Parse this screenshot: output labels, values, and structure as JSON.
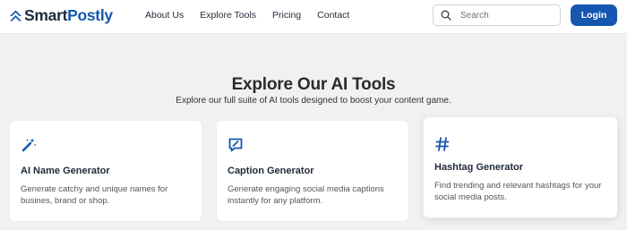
{
  "header": {
    "logo_text_dark": "Smart",
    "logo_text_brand": "Postly",
    "nav": [
      "About Us",
      "Explore Tools",
      "Pricing",
      "Contact"
    ],
    "search_placeholder": "Search",
    "login_label": "Login"
  },
  "hero": {
    "title": "Explore Our AI Tools",
    "subtitle": "Explore our full suite of AI tools designed to boost your content game."
  },
  "tools": [
    {
      "icon": "magic-wand-icon",
      "title": "AI Name Generator",
      "description": "Generate catchy and unique names for busines, brand or shop."
    },
    {
      "icon": "caption-edit-icon",
      "title": "Caption Generator",
      "description": "Generate engaging social media captions instantly for any platform."
    },
    {
      "icon": "hashtag-icon",
      "title": "Hashtag Generator",
      "description": "Find trending and relevant hashtags for your social media posts."
    }
  ],
  "colors": {
    "brand": "#1557b0",
    "background": "#f1f1f1",
    "card": "#ffffff"
  }
}
